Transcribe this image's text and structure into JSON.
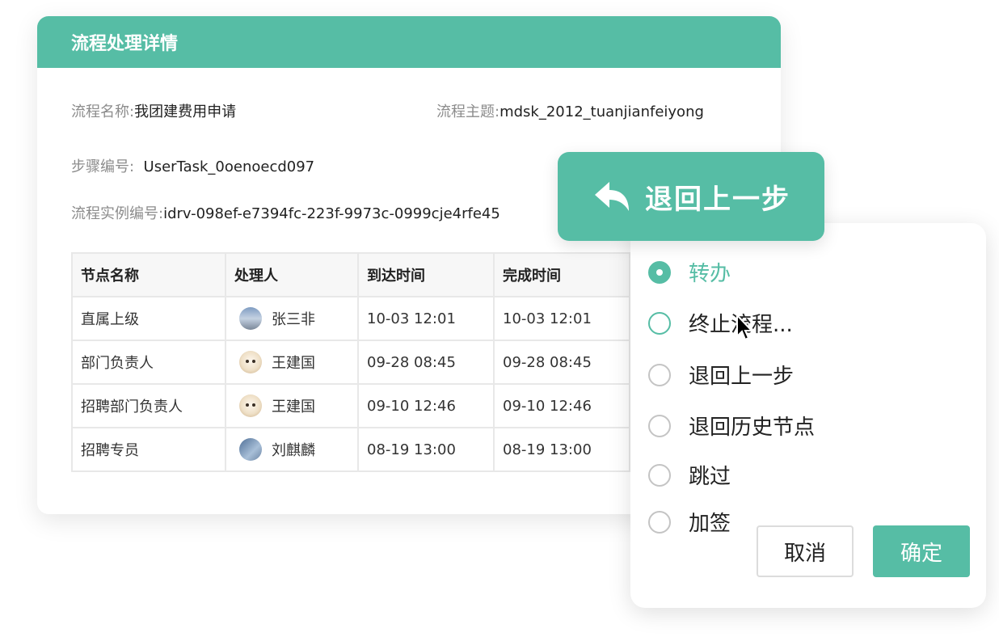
{
  "card": {
    "title": "流程处理详情",
    "fields": {
      "process_name_label": "流程名称:",
      "process_name_value": "我团建费用申请",
      "process_subject_label": "流程主题:",
      "process_subject_value": "mdsk_2012_tuanjianfeiyong",
      "step_id_label": "步骤编号:",
      "step_id_value": "UserTask_0oenoecd097",
      "instance_id_label": "流程实例编号:",
      "instance_id_value": "idrv-098ef-e7394fc-223f-9973c-0999cje4rfe45"
    }
  },
  "table": {
    "headers": [
      "节点名称",
      "处理人",
      "到达时间",
      "完成时间"
    ],
    "rows": [
      {
        "node": "直属上级",
        "handler": "张三非",
        "arrival": "10-03 12:01",
        "finish": "10-03 12:01"
      },
      {
        "node": "部门负责人",
        "handler": "王建国",
        "arrival": "09-28 08:45",
        "finish": "09-28 08:45"
      },
      {
        "node": "招聘部门负责人",
        "handler": "王建国",
        "arrival": "09-10 12:46",
        "finish": "09-10 12:46"
      },
      {
        "node": "招聘专员",
        "handler": "刘麒麟",
        "arrival": "08-19 13:00",
        "finish": "08-19 13:00"
      }
    ]
  },
  "bubble": {
    "icon": "reply-arrow-icon",
    "label": "退回上一步"
  },
  "panel": {
    "options": [
      {
        "label": "转办",
        "selected": true
      },
      {
        "label": "终止流程...",
        "selected": false
      },
      {
        "label": "退回上一步",
        "selected": false
      },
      {
        "label": "退回历史节点",
        "selected": false
      },
      {
        "label": "跳过",
        "selected": false
      },
      {
        "label": "加签",
        "selected": false
      }
    ],
    "cancel_label": "取消",
    "confirm_label": "确定"
  },
  "colors": {
    "accent": "#56bda5",
    "label_gray": "#8c8c8c",
    "border": "#e8e8e8"
  }
}
